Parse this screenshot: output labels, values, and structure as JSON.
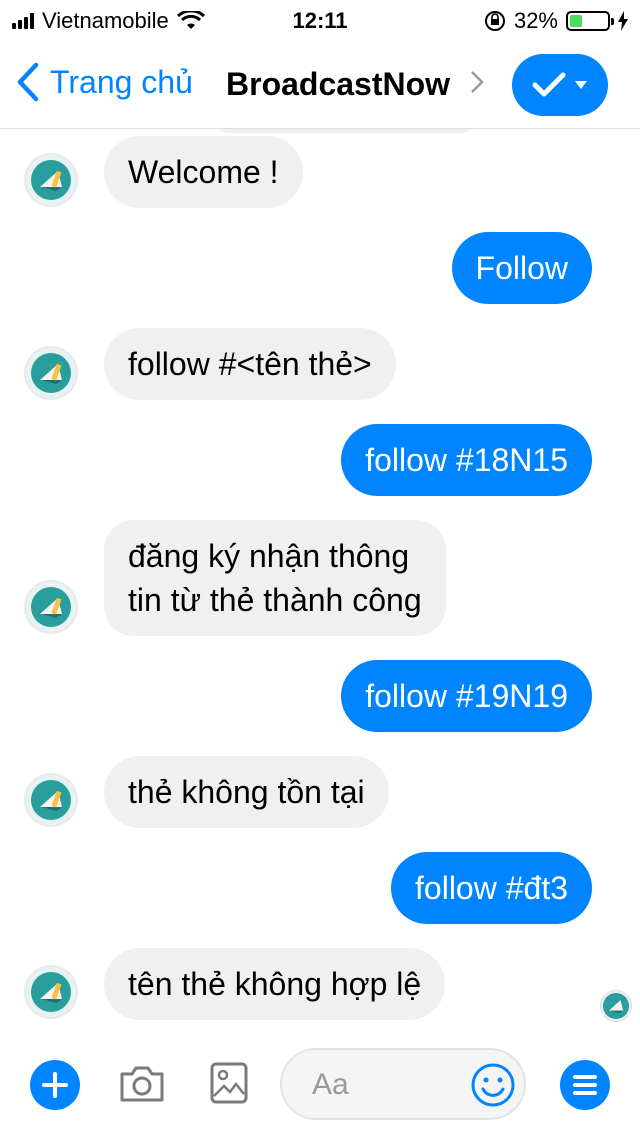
{
  "status_bar": {
    "carrier": "Vietnamobile",
    "time": "12:11",
    "battery": "32%",
    "battery_level": 0.32
  },
  "nav": {
    "back_label": "Trang chủ",
    "title": "BroadcastNow",
    "action_icon": "checkmark-icon"
  },
  "messages": [
    {
      "from": "bot",
      "text": "Welcome !"
    },
    {
      "from": "user",
      "text": "Follow"
    },
    {
      "from": "bot",
      "text": "follow #<tên thẻ>"
    },
    {
      "from": "user",
      "text": "follow #18N15"
    },
    {
      "from": "bot",
      "lines": [
        "đăng ký nhận thông",
        "tin từ thẻ thành công"
      ]
    },
    {
      "from": "user",
      "text": "follow #19N19"
    },
    {
      "from": "bot",
      "text": "thẻ không tồn tại"
    },
    {
      "from": "user",
      "text": "follow #đt3"
    },
    {
      "from": "bot",
      "text": "tên thẻ không hợp lệ"
    }
  ],
  "composer": {
    "placeholder": "Aa"
  },
  "colors": {
    "accent": "#0084ff",
    "incoming_bubble": "#f1f0f0",
    "avatar_teal": "#2a9d9d"
  }
}
